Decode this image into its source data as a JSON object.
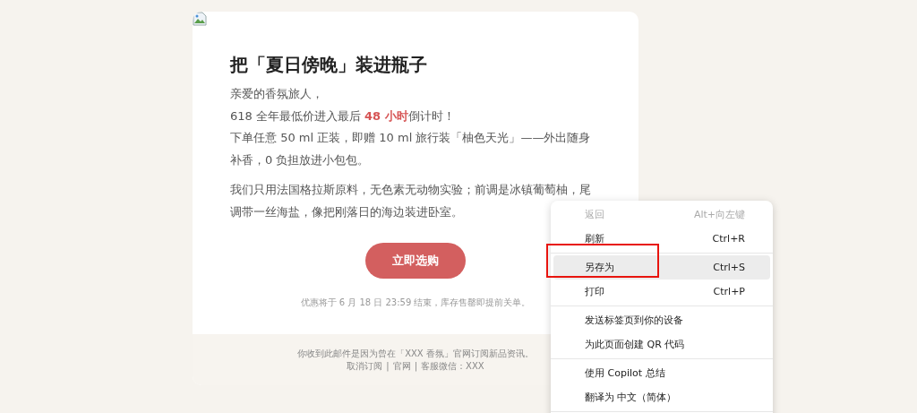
{
  "email": {
    "title": "把「夏日傍晚」装进瓶子",
    "paragraphs": [
      {
        "lines": [
          "亲爱的香氛旅人，",
          "618 全年最低价进入最后 **48 小时**倒计时！",
          "下单任意 50 ml 正装，即赠 10 ml 旅行装「柚色天光」——外出随身",
          "补香，0 负担放进小包包。"
        ]
      },
      {
        "lines": [
          "我们只用法国格拉斯原料，无色素无动物实验；前调是冰镇葡萄柚，尾",
          "调带一丝海盐，像把刚落日的海边装进卧室。"
        ]
      }
    ],
    "cta": "立即选购",
    "note": "优惠将于 6 月 18 日 23:59 结束，库存售罄即提前关单。",
    "footer": {
      "text": "你收到此邮件是因为曾在「XXX 香氛」官网订阅新品资讯。",
      "links": [
        "取消订阅",
        "官网",
        "客服微信：XXX"
      ],
      "separator": "|"
    }
  },
  "context_menu": {
    "items": [
      {
        "kind": "item",
        "label": "返回",
        "shortcut": "Alt+向左键",
        "disabled": true,
        "selected": false
      },
      {
        "kind": "item",
        "label": "刷新",
        "shortcut": "Ctrl+R",
        "disabled": false,
        "selected": false
      },
      {
        "kind": "separator"
      },
      {
        "kind": "item",
        "label": "另存为",
        "shortcut": "Ctrl+S",
        "disabled": false,
        "selected": true
      },
      {
        "kind": "item",
        "label": "打印",
        "shortcut": "Ctrl+P",
        "disabled": false,
        "selected": false
      },
      {
        "kind": "separator"
      },
      {
        "kind": "item",
        "label": "发送标签页到你的设备",
        "disabled": false,
        "selected": false
      },
      {
        "kind": "item",
        "label": "为此页面创建 QR 代码",
        "disabled": false,
        "selected": false
      },
      {
        "kind": "separator"
      },
      {
        "kind": "item",
        "label": "使用 Copilot 总结",
        "disabled": false,
        "selected": false
      },
      {
        "kind": "item",
        "label": "翻译为 中文（简体）",
        "disabled": false,
        "selected": false
      },
      {
        "kind": "separator"
      }
    ]
  }
}
